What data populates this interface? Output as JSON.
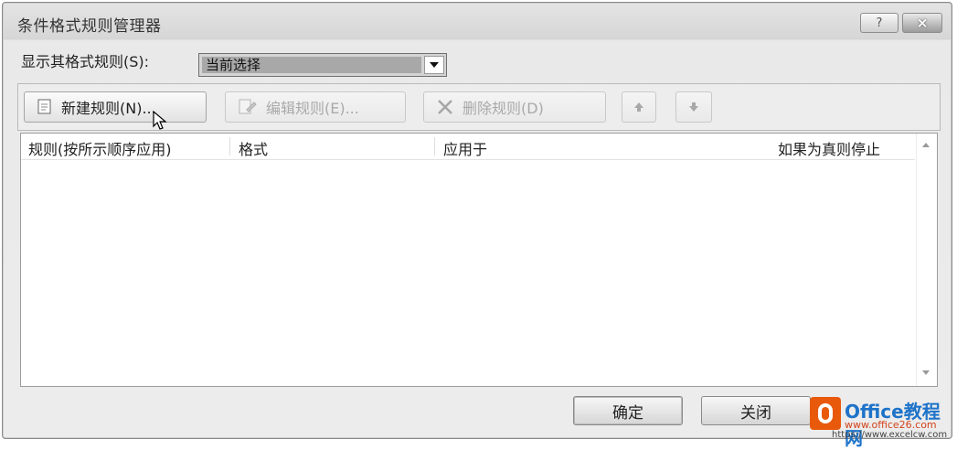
{
  "window": {
    "title": "条件格式规则管理器",
    "help_label": "?",
    "close_label": "×"
  },
  "show_rules": {
    "label": "显示其格式规则(S):",
    "value": "当前选择"
  },
  "toolbar": {
    "new_rule": "新建规则(N)...",
    "edit_rule": "编辑规则(E)...",
    "delete_rule": "删除规则(D)"
  },
  "table": {
    "columns": [
      "规则(按所示顺序应用)",
      "格式",
      "应用于",
      "如果为真则停止"
    ],
    "rows": []
  },
  "buttons": {
    "ok": "确定",
    "close": "关闭"
  },
  "watermark": {
    "title": "Office教程网",
    "site1": "www.office26.com",
    "site2": "https://www.excelcw.com"
  },
  "colors": {
    "dialog_bg": "#ececec",
    "selected_value_bg": "#a8a8a8",
    "watermark_orange": "#e8590c",
    "watermark_blue": "#1e73c9"
  }
}
